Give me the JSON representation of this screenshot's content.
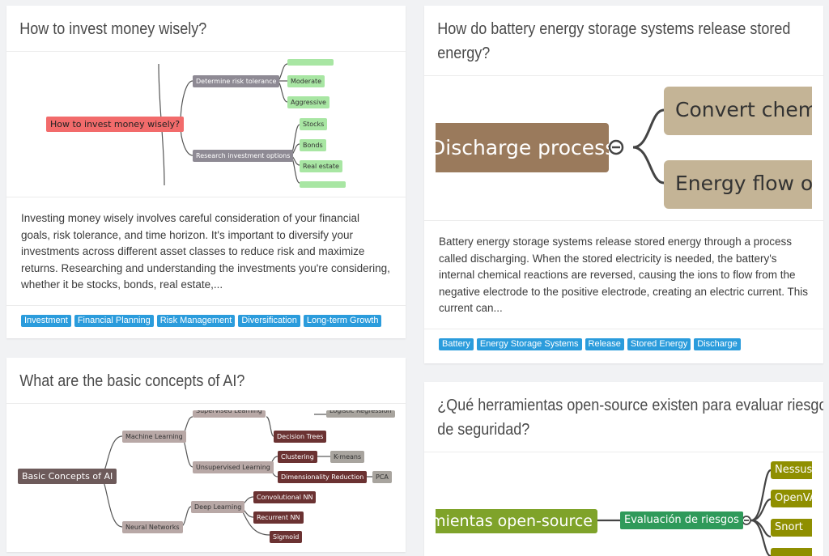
{
  "cards": [
    {
      "title": "How to invest money wisely?",
      "description": "Investing money wisely involves careful consideration of your financial goals, risk tolerance, and time horizon. It's important to diversify your investments across different asset classes to reduce risk and maximize returns. Researching and understanding the investments you're considering, whether it be stocks, bonds, real estate,...",
      "tags": [
        "Investment",
        "Financial Planning",
        "Risk Management",
        "Diversification",
        "Long-term Growth"
      ],
      "mindmap": {
        "root": "How to invest money wisely?",
        "branches": [
          {
            "label": "Determine risk tolerance",
            "children": [
              "Moderate",
              "Aggressive"
            ]
          },
          {
            "label": "Research investment options",
            "children": [
              "Stocks",
              "Bonds",
              "Real estate"
            ]
          }
        ]
      }
    },
    {
      "title": "What are the basic concepts of AI?",
      "mindmap": {
        "root": "Basic Concepts of AI",
        "branches": [
          {
            "label": "Machine Learning",
            "children": [
              "Supervised Learning",
              "Unsupervised Learning"
            ]
          },
          {
            "label": "Neural Networks",
            "children": [
              "Deep Learning"
            ]
          }
        ],
        "leaves": [
          "Logistic Regression",
          "Decision Trees",
          "Clustering",
          "K-means",
          "Dimensionality Reduction",
          "PCA",
          "Convolutional NN",
          "Recurrent NN",
          "Sigmoid"
        ]
      }
    },
    {
      "title": "How do battery energy storage systems release stored energy?",
      "description": "Battery energy storage systems release stored energy through a process called discharging. When the stored electricity is needed, the battery's internal chemical reactions are reversed, causing the ions to flow from the negative electrode to the positive electrode, creating an electric current. This current can...",
      "tags": [
        "Battery",
        "Energy Storage Systems",
        "Release",
        "Stored Energy",
        "Discharge"
      ],
      "mindmap": {
        "root": "Discharge process",
        "children": [
          "Convert chemical energy",
          "Energy flow out"
        ]
      }
    },
    {
      "title": "¿Qué herramientas open-source existen para evaluar riesgos de seguridad?",
      "mindmap": {
        "root": "Herramientas open-source",
        "branch": "Evaluación de riesgos",
        "children": [
          "Nessus",
          "OpenVAS",
          "Snort"
        ]
      }
    }
  ],
  "colors": {
    "tag": "#2b9cdc",
    "invest_root": "#f26b6b",
    "invest_branch": "#8e8a94",
    "invest_leaf": "#a8e6a3",
    "ai_root": "#6d5a5a",
    "ai_branch": "#b8a8a6",
    "ai_leaf": "#6b3232",
    "battery_root": "#9a7a5c",
    "battery_child": "#c4b496",
    "sec_root": "#7fa32a",
    "sec_branch": "#2f9a5a",
    "sec_leaf": "#8f8f00"
  }
}
